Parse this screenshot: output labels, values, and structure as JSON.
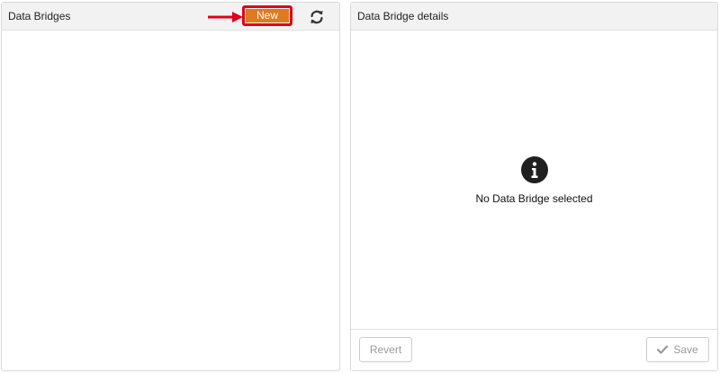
{
  "left_panel": {
    "title": "Data Bridges",
    "new_label": "New",
    "refresh_icon": "refresh-icon",
    "arrow_icon": "arrow-right-icon"
  },
  "right_panel": {
    "title": "Data Bridge details",
    "empty_icon": "info-icon",
    "empty_message": "No Data Bridge selected",
    "revert_label": "Revert",
    "save_label": "Save",
    "save_icon": "check-icon"
  },
  "colors": {
    "new_button": "#e07a1f",
    "highlight": "#e0001a"
  }
}
